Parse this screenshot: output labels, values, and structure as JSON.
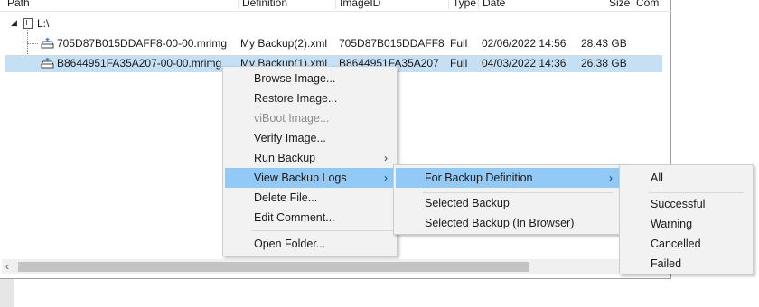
{
  "list": {
    "columns": [
      "Path",
      "Definition",
      "ImageID",
      "Type",
      "Date",
      "Size",
      "Com"
    ],
    "root": "L:\\",
    "rows": [
      {
        "path": "705D87B015DDAFF8-00-00.mrimg",
        "definition": "My Backup(2).xml",
        "image_id": "705D87B015DDAFF8",
        "type": "Full",
        "date": "02/06/2022 14:56",
        "size": "28.43 GB"
      },
      {
        "path": "B8644951FA35A207-00-00.mrimg",
        "definition": "My Backup(1).xml",
        "image_id": "B8644951FA35A207",
        "type": "Full",
        "date": "04/03/2022 14:36",
        "size": "26.38 GB",
        "selected": true
      }
    ]
  },
  "context_menu": {
    "items": [
      "Browse Image...",
      "Restore Image...",
      "viBoot Image...",
      "Verify Image...",
      "Run Backup",
      "View Backup Logs",
      "Delete File...",
      "Edit Comment...",
      "Open Folder..."
    ]
  },
  "submenu_logs": {
    "items": [
      "For Backup Definition",
      "Selected Backup",
      "Selected Backup (In Browser)"
    ]
  },
  "submenu_definition": {
    "items": [
      "All",
      "Successful",
      "Warning",
      "Cancelled",
      "Failed"
    ]
  },
  "icons": {
    "expand": "triangle-down-icon",
    "drive": "drive-icon",
    "image_file": "backup-image-icon",
    "submenu_arrow": "chevron-right-icon",
    "scroll_left": "chevron-left-icon"
  },
  "colors": {
    "selection": "#c5dff5",
    "menu_highlight": "#91c9f7",
    "menu_bg": "#f2f2f2"
  }
}
